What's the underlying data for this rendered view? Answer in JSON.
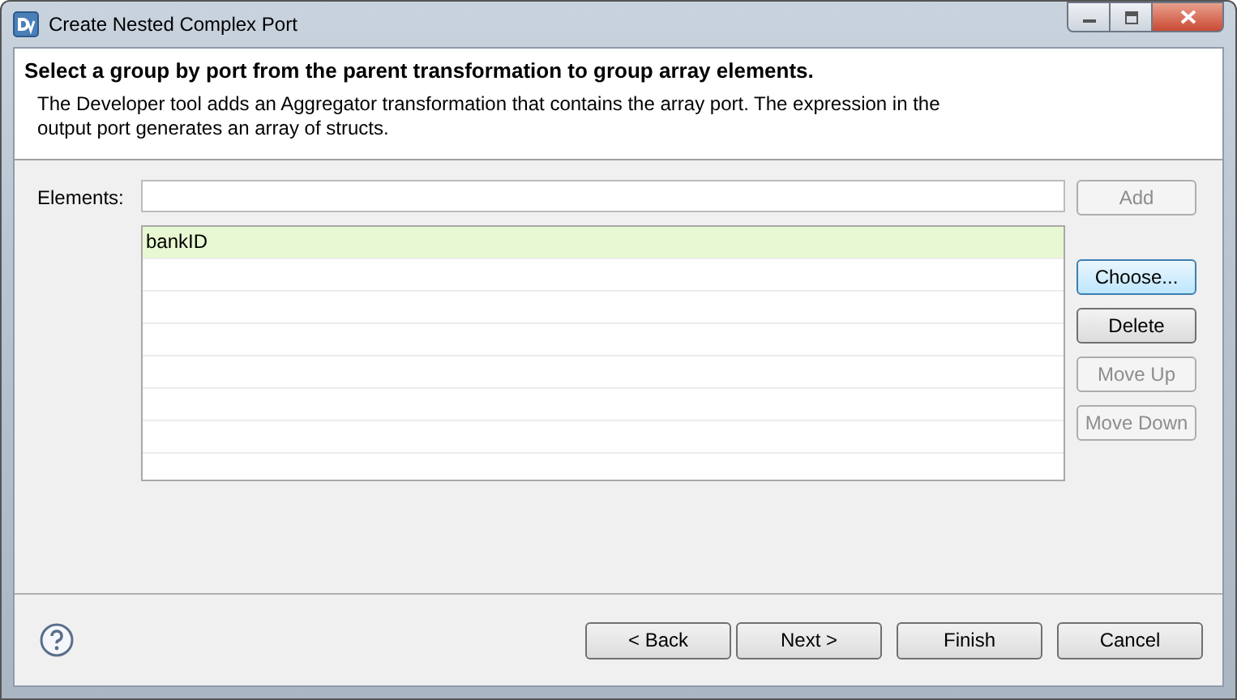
{
  "window": {
    "title": "Create Nested Complex Port"
  },
  "header": {
    "title": "Select a group by port from the parent transformation to group array elements.",
    "description": "The Developer tool adds an Aggregator transformation that contains the array port. The expression in the output port generates an array of structs."
  },
  "elements": {
    "label": "Elements:",
    "items": [
      {
        "text": "bankID",
        "selected": true
      }
    ]
  },
  "side_buttons": [
    {
      "label": "Add",
      "disabled": true,
      "focused": false
    },
    {
      "label": "Choose...",
      "disabled": false,
      "focused": true
    },
    {
      "label": "Delete",
      "disabled": false,
      "focused": false
    },
    {
      "label": "Move Up",
      "disabled": true,
      "focused": false
    },
    {
      "label": "Move Down",
      "disabled": true,
      "focused": false
    }
  ],
  "footer_buttons": [
    {
      "label": "< Back",
      "disabled": false
    },
    {
      "label": "Next >",
      "disabled": false
    },
    {
      "label": "Finish",
      "disabled": false
    },
    {
      "label": "Cancel",
      "disabled": false
    }
  ]
}
